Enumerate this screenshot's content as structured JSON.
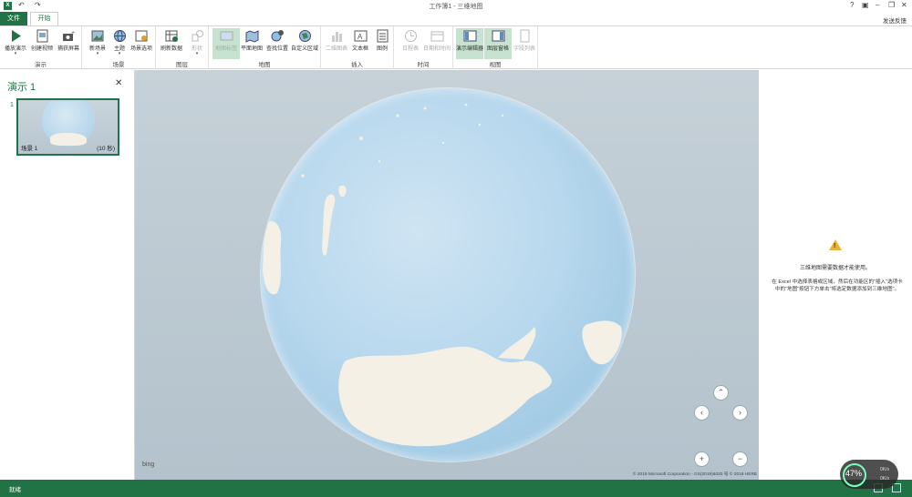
{
  "titlebar": {
    "title": "工作簿1 - 三维地图",
    "app_icon": "excel-icon",
    "quick_access": [
      "undo-icon",
      "redo-icon"
    ],
    "window_controls": [
      "help-icon",
      "restore-ribbon-icon",
      "minimize-icon",
      "maximize-icon",
      "close-icon"
    ]
  },
  "tabs": {
    "file": "文件",
    "home": "开始",
    "feedback": "发送反馈"
  },
  "ribbon": {
    "groups": [
      {
        "label": "演示",
        "buttons": [
          {
            "label": "播放演示",
            "icon": "play-icon"
          },
          {
            "label": "创建视频",
            "icon": "video-icon"
          },
          {
            "label": "捕获屏幕",
            "icon": "camera-icon"
          }
        ]
      },
      {
        "label": "场景",
        "buttons": [
          {
            "label": "新场景",
            "icon": "new-scene-icon"
          },
          {
            "label": "主题",
            "icon": "theme-globe-icon"
          },
          {
            "label": "场景选项",
            "icon": "scene-options-icon"
          }
        ]
      },
      {
        "label": "图层",
        "buttons": [
          {
            "label": "刷新数据",
            "icon": "refresh-data-icon"
          },
          {
            "label": "形状",
            "icon": "shapes-icon"
          }
        ]
      },
      {
        "label": "地图",
        "buttons": [
          {
            "label": "地图标签",
            "icon": "map-labels-icon"
          },
          {
            "label": "平面地图",
            "icon": "flat-map-icon"
          },
          {
            "label": "查找位置",
            "icon": "find-location-icon"
          },
          {
            "label": "自定义区域",
            "icon": "custom-region-icon"
          }
        ]
      },
      {
        "label": "插入",
        "buttons": [
          {
            "label": "二维图表",
            "icon": "chart-2d-icon"
          },
          {
            "label": "文本框",
            "icon": "textbox-icon"
          },
          {
            "label": "图例",
            "icon": "legend-icon"
          }
        ]
      },
      {
        "label": "时间",
        "buttons": [
          {
            "label": "日程表",
            "icon": "timeline-icon"
          },
          {
            "label": "日期和时间",
            "icon": "datetime-icon"
          }
        ]
      },
      {
        "label": "视图",
        "buttons": [
          {
            "label": "演示编辑器",
            "icon": "tour-editor-icon"
          },
          {
            "label": "图层窗格",
            "icon": "layer-pane-icon"
          },
          {
            "label": "字段列表",
            "icon": "field-list-icon"
          }
        ]
      }
    ]
  },
  "tour_pane": {
    "title": "演示 1",
    "scene_number": "1",
    "scene_label": "场景 1",
    "scene_duration": "(10 秒)"
  },
  "map": {
    "bing": "bing",
    "copyright": "© 2019 Microsoft Corporation - GS(2019)6020 号 © 2019 HERE",
    "nav": [
      "tilt-up-icon",
      "rotate-left-icon",
      "rotate-right-icon",
      "zoom-in-icon",
      "zoom-out-icon"
    ]
  },
  "info_pane": {
    "icon": "warning-icon",
    "message_title": "三维地图需要数据才能使用。",
    "message_body": "在 Excel 中选择表格或区域，然后在功能区的“插入”选项卡中的“地图”按钮下方单击“将选定数据添加到三维地图”。"
  },
  "status": {
    "text": "就绪"
  },
  "perf_widget": {
    "percent": "47%",
    "up": "0K/s",
    "down": "0K/s"
  }
}
